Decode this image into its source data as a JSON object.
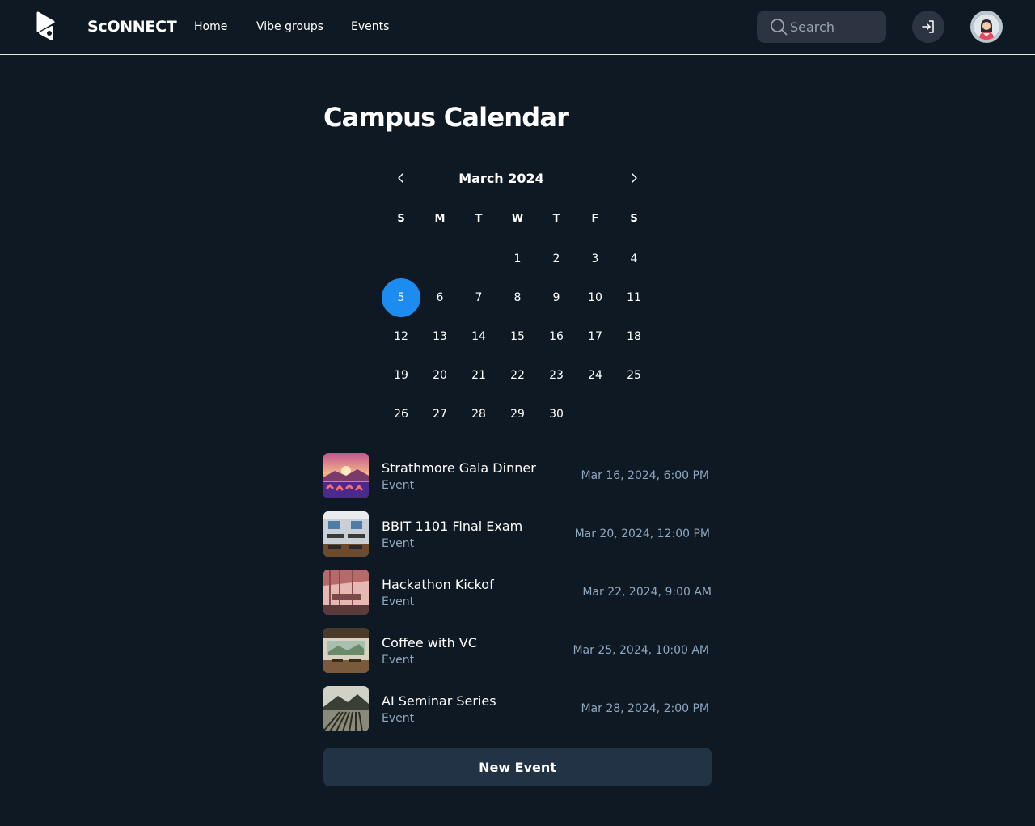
{
  "header": {
    "brand": "ScONNECT",
    "nav": [
      {
        "label": "Home"
      },
      {
        "label": "Vibe groups"
      },
      {
        "label": "Events"
      }
    ],
    "search": {
      "placeholder": "Search",
      "icon": "search-icon"
    },
    "login_icon": "login-icon",
    "avatar_icon": "user-avatar"
  },
  "page": {
    "title": "Campus Calendar"
  },
  "calendar": {
    "month_label": "March 2024",
    "prev_icon": "chevron-left-icon",
    "next_icon": "chevron-right-icon",
    "weekdays": [
      "S",
      "M",
      "T",
      "W",
      "T",
      "F",
      "S"
    ],
    "weeks": [
      [
        "",
        "",
        "",
        "1",
        "2",
        "3",
        "4"
      ],
      [
        "5",
        "6",
        "7",
        "8",
        "9",
        "10",
        "11"
      ],
      [
        "12",
        "13",
        "14",
        "15",
        "16",
        "17",
        "18"
      ],
      [
        "19",
        "20",
        "21",
        "22",
        "23",
        "24",
        "25"
      ],
      [
        "26",
        "27",
        "28",
        "29",
        "30",
        "",
        ""
      ]
    ],
    "selected_day": "5",
    "selected_color": "#1d8cf0"
  },
  "events": [
    {
      "name": "Strathmore Gala Dinner",
      "type": "Event",
      "date": "Mar 16, 2024, 6:00 PM"
    },
    {
      "name": "BBIT 1101 Final Exam",
      "type": "Event",
      "date": "Mar 20, 2024, 12:00 PM"
    },
    {
      "name": "Hackathon Kickof",
      "type": "Event",
      "date": "Mar 22, 2024, 9:00 AM"
    },
    {
      "name": "Coffee with VC",
      "type": "Event",
      "date": "Mar 25, 2024, 10:00 AM"
    },
    {
      "name": "AI Seminar Series",
      "type": "Event",
      "date": "Mar 28, 2024, 2:00 PM"
    }
  ],
  "actions": {
    "new_event_label": "New Event"
  },
  "colors": {
    "background": "#0f1924",
    "accent": "#1d8cf0",
    "muted_text": "#8fa6bf",
    "button_bg": "#223346"
  }
}
